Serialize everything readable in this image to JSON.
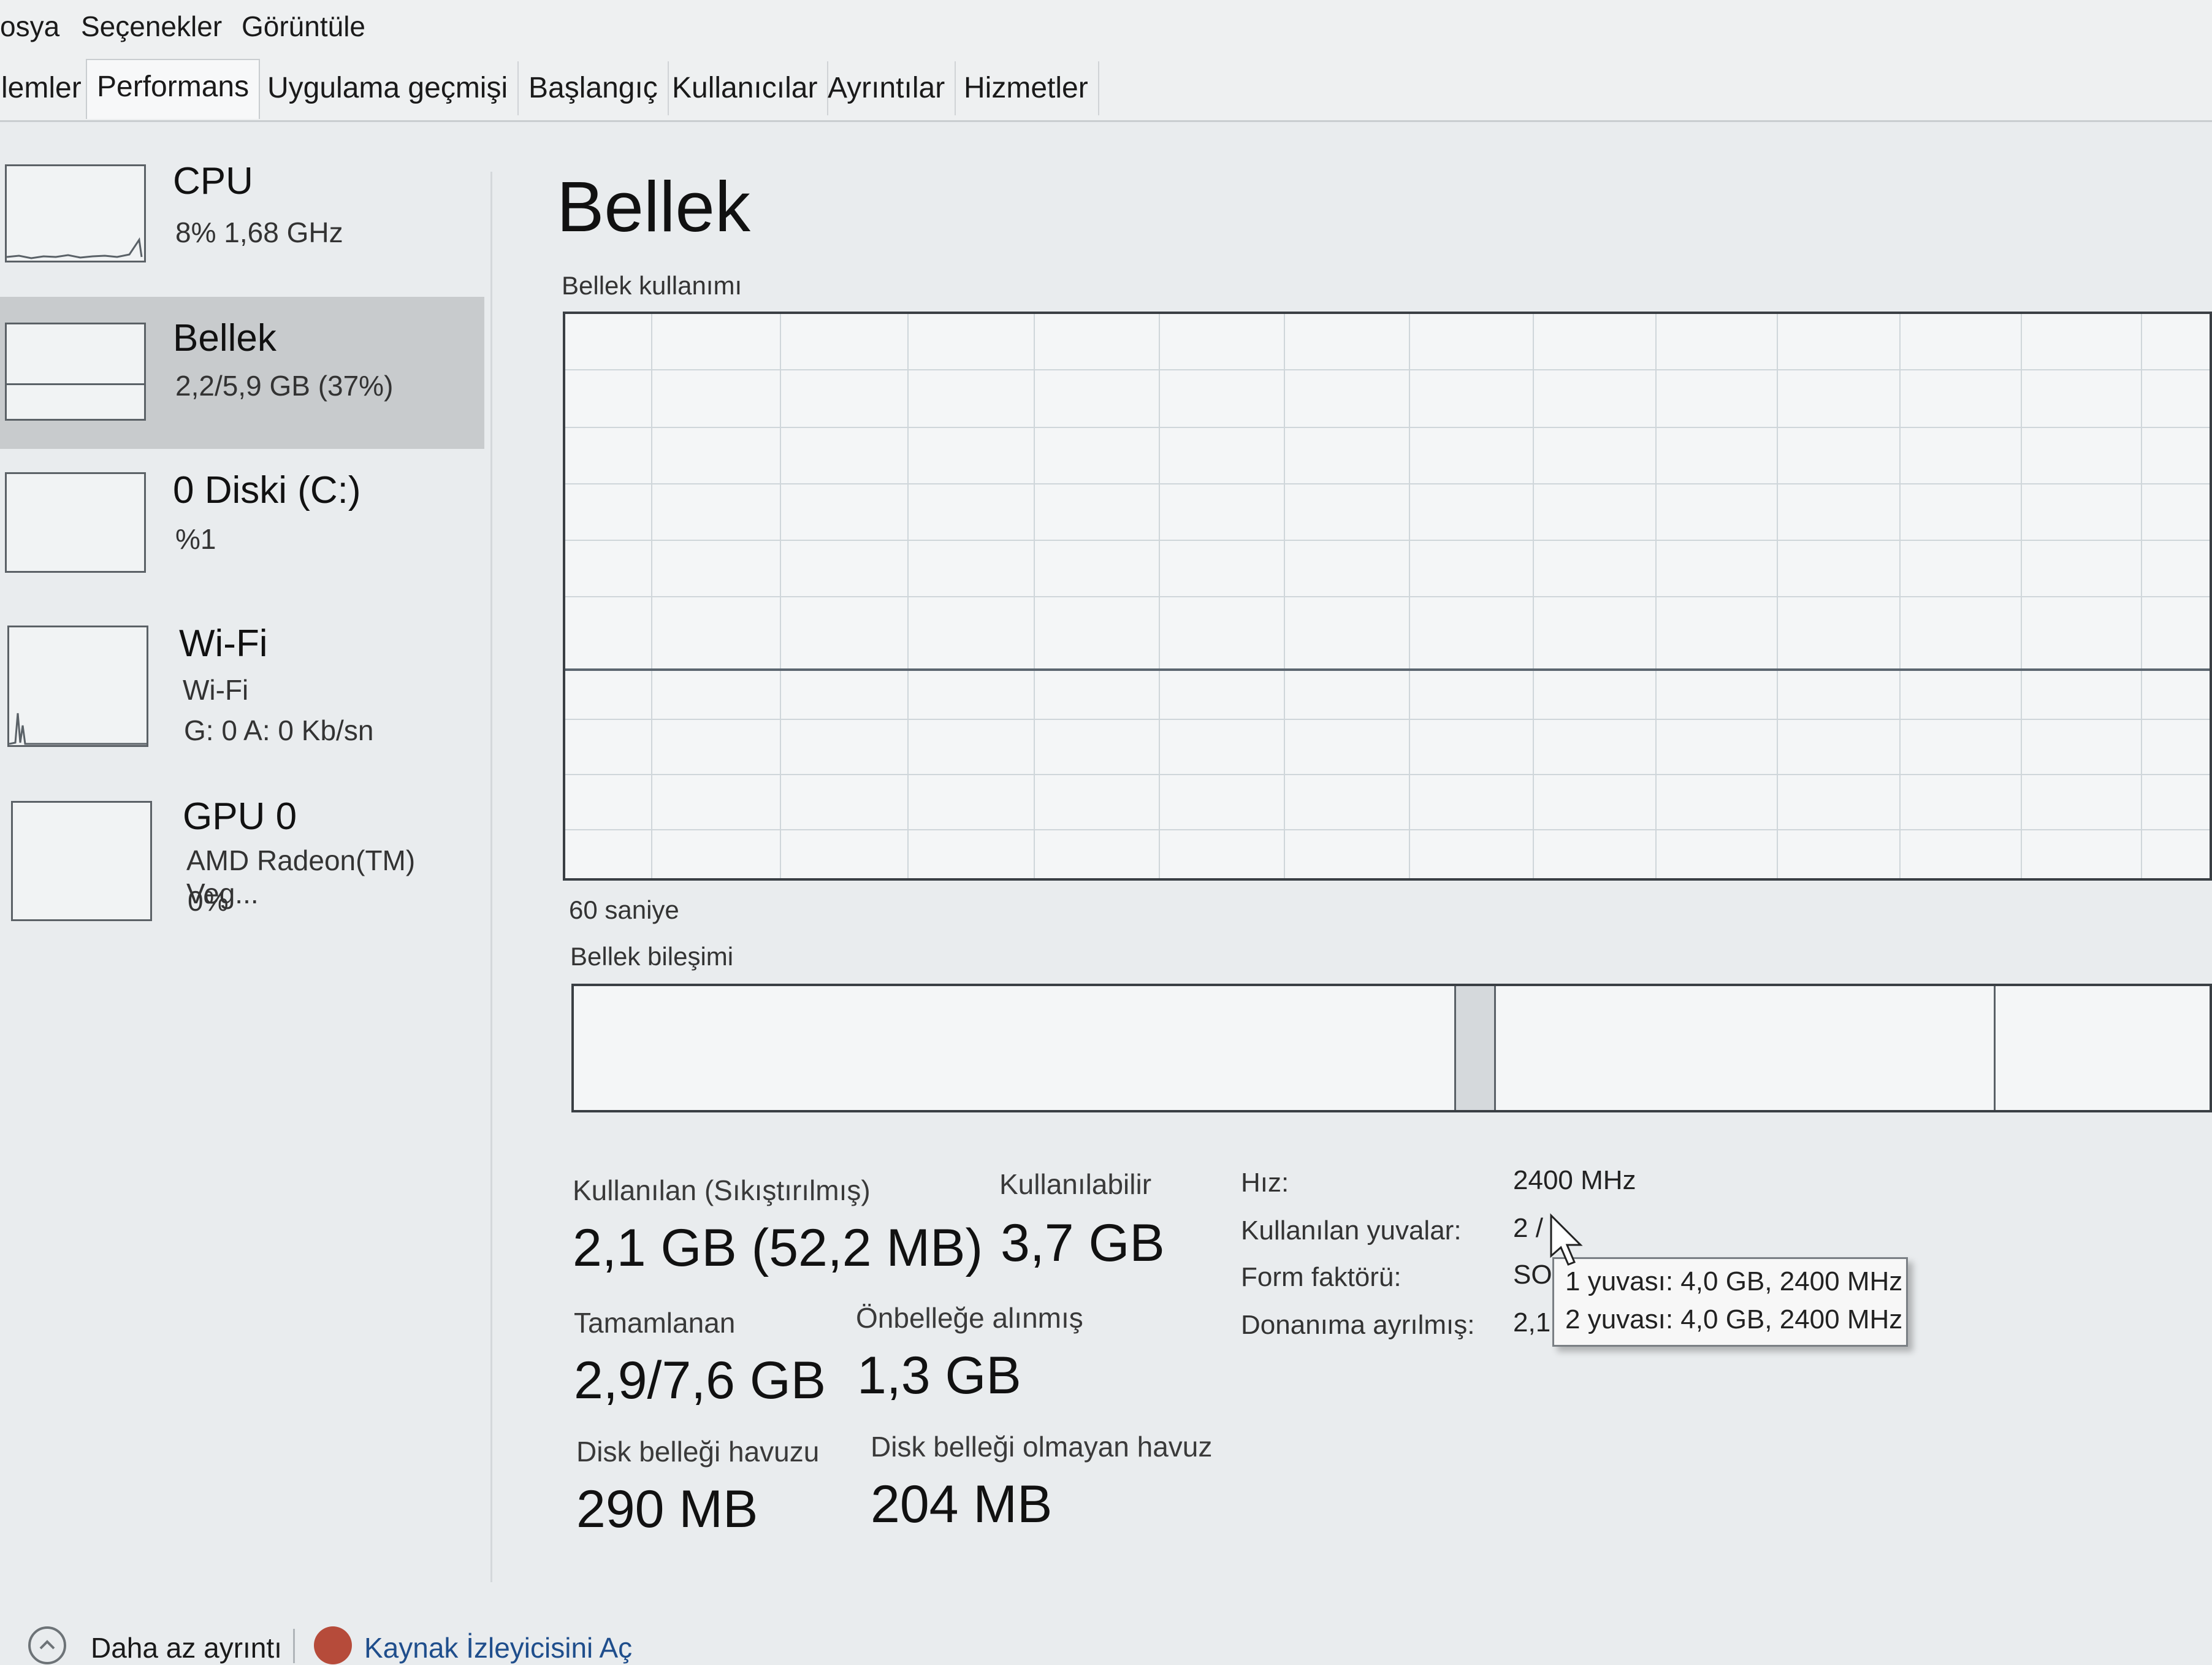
{
  "menu": [
    "osya",
    "Seçenekler",
    "Görüntüle"
  ],
  "tabs": [
    {
      "label": "lemler",
      "active": false
    },
    {
      "label": "Performans",
      "active": true
    },
    {
      "label": "Uygulama geçmişi",
      "active": false
    },
    {
      "label": "Başlangıç",
      "active": false
    },
    {
      "label": "Kullanıcılar",
      "active": false
    },
    {
      "label": "Ayrıntılar",
      "active": false
    },
    {
      "label": "Hizmetler",
      "active": false
    }
  ],
  "sidebar": {
    "items": [
      {
        "title": "CPU",
        "line1": "8%  1,68 GHz",
        "line2": "",
        "selected": false
      },
      {
        "title": "Bellek",
        "line1": "2,2/5,9 GB (37%)",
        "line2": "",
        "selected": true
      },
      {
        "title": "0 Diski (C:)",
        "line1": "%1",
        "line2": "",
        "selected": false
      },
      {
        "title": "Wi-Fi",
        "line1": "Wi-Fi",
        "line2": "G: 0  A: 0 Kb/sn",
        "selected": false
      },
      {
        "title": "GPU 0",
        "line1": "AMD Radeon(TM) Veg...",
        "line2": "0%",
        "selected": false
      }
    ]
  },
  "main": {
    "title": "Bellek",
    "usage_label": "Bellek kullanımı",
    "time_label": "60 saniye",
    "composition_label": "Bellek bileşimi",
    "usage_level": 0.37,
    "stats": {
      "used_label": "Kullanılan (Sıkıştırılmış)",
      "used_value": "2,1 GB (52,2 MB)",
      "available_label": "Kullanılabilir",
      "available_value": "3,7 GB",
      "committed_label": "Tamamlanan",
      "committed_value": "2,9/7,6 GB",
      "cached_label": "Önbelleğe alınmış",
      "cached_value": "1,3 GB",
      "paged_label": "Disk belleği havuzu",
      "paged_value": "290 MB",
      "nonpaged_label": "Disk belleği olmayan havuz",
      "nonpaged_value": "204 MB"
    },
    "specs": {
      "speed_label": "Hız:",
      "speed_value": "2400 MHz",
      "slots_label": "Kullanılan yuvalar:",
      "slots_value": "2 /",
      "form_label": "Form faktörü:",
      "form_value": "SO",
      "reserved_label": "Donanıma ayrılmış:",
      "reserved_value": "2,1"
    },
    "tooltip": {
      "line1": "1 yuvası: 4,0 GB, 2400 MHz",
      "line2": "2 yuvası: 4,0 GB, 2400 MHz"
    }
  },
  "footer": {
    "less_details": "Daha az ayrıntı",
    "resource_monitor": "Kaynak İzleyicisini Aç"
  },
  "colors": {
    "accent_line": "#5c6670",
    "selected_bg": "#c8cbcd",
    "link": "#1f4e8c"
  }
}
